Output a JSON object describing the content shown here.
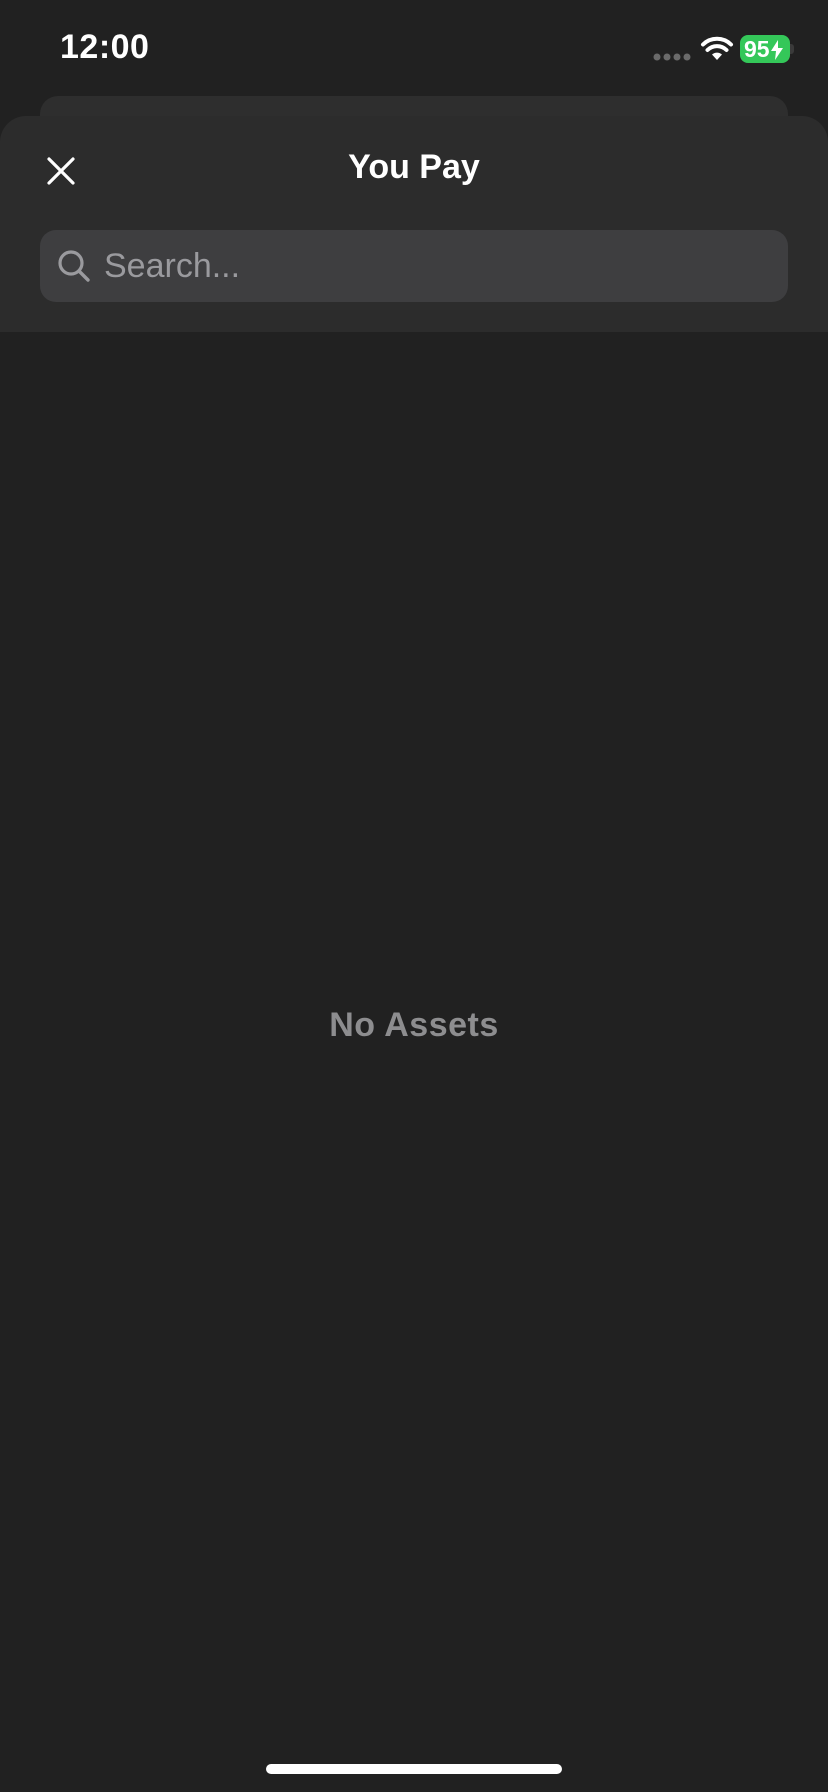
{
  "status_bar": {
    "time": "12:00",
    "battery_level": "95",
    "battery_color": "#34c759",
    "icons": [
      "cellular-signal-icon",
      "wifi-icon",
      "battery-charging-icon"
    ]
  },
  "sheet": {
    "title": "You Pay",
    "close_icon": "close-icon"
  },
  "search": {
    "value": "",
    "placeholder": "Search...",
    "icon": "search-icon"
  },
  "empty_state": {
    "message": "No Assets"
  },
  "colors": {
    "background": "#212121",
    "header_background": "#2c2c2c",
    "search_background": "#3e3e40",
    "muted_text": "#8d8d8f"
  }
}
